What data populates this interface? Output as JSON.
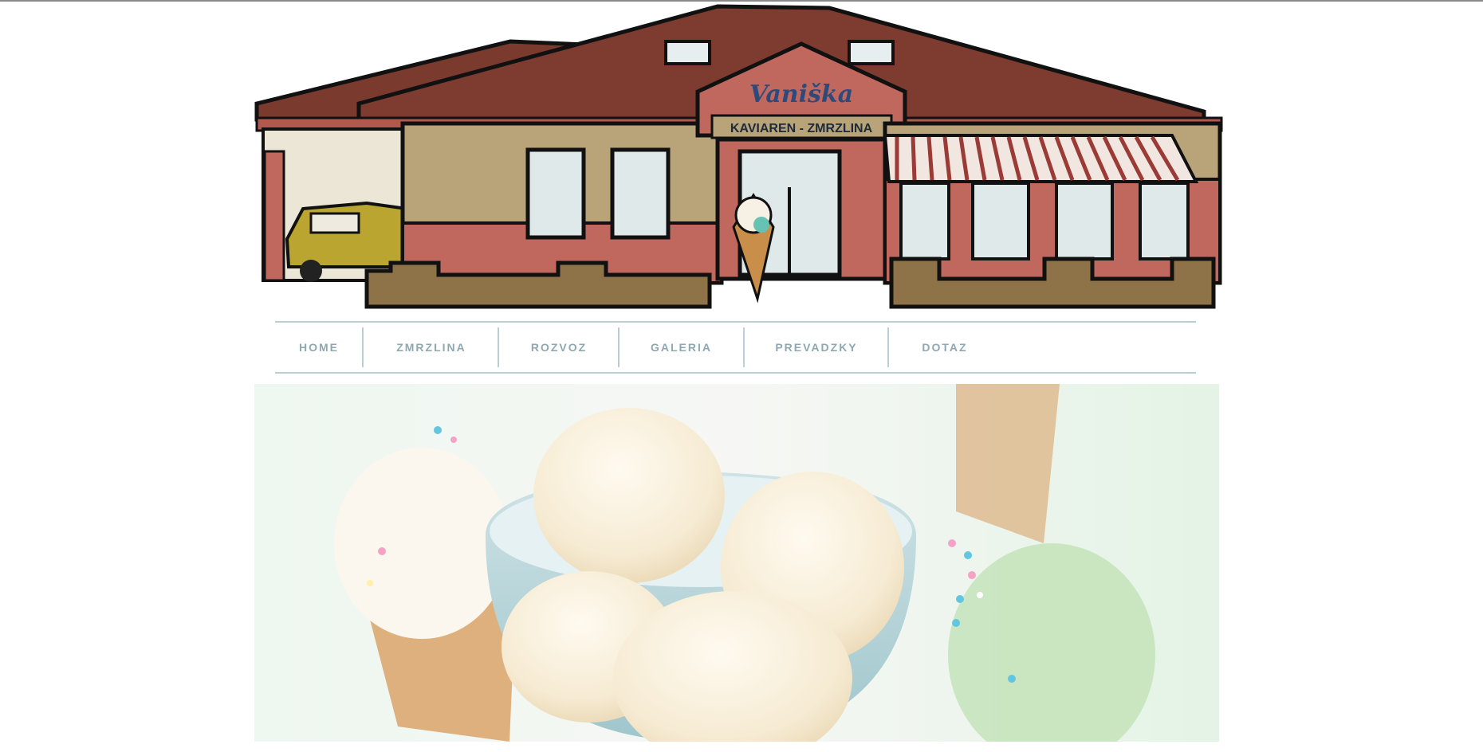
{
  "header": {
    "sign_script": "Vaniška",
    "sign_text": "KAVIAREN - ZMRZLINA"
  },
  "nav": {
    "items": [
      {
        "label": "HOME"
      },
      {
        "label": "ZMRZLINA"
      },
      {
        "label": "ROZVOZ"
      },
      {
        "label": "GALERIA"
      },
      {
        "label": "PREVADZKY"
      },
      {
        "label": "DOTAZ"
      }
    ]
  },
  "colors": {
    "roof": "#7a3a2e",
    "wall": "#b9a47a",
    "trim": "#c0685e",
    "nav_text": "#8fa8b0",
    "nav_rule": "#b9cfd2",
    "hero_bg": "#e8f5ea"
  }
}
